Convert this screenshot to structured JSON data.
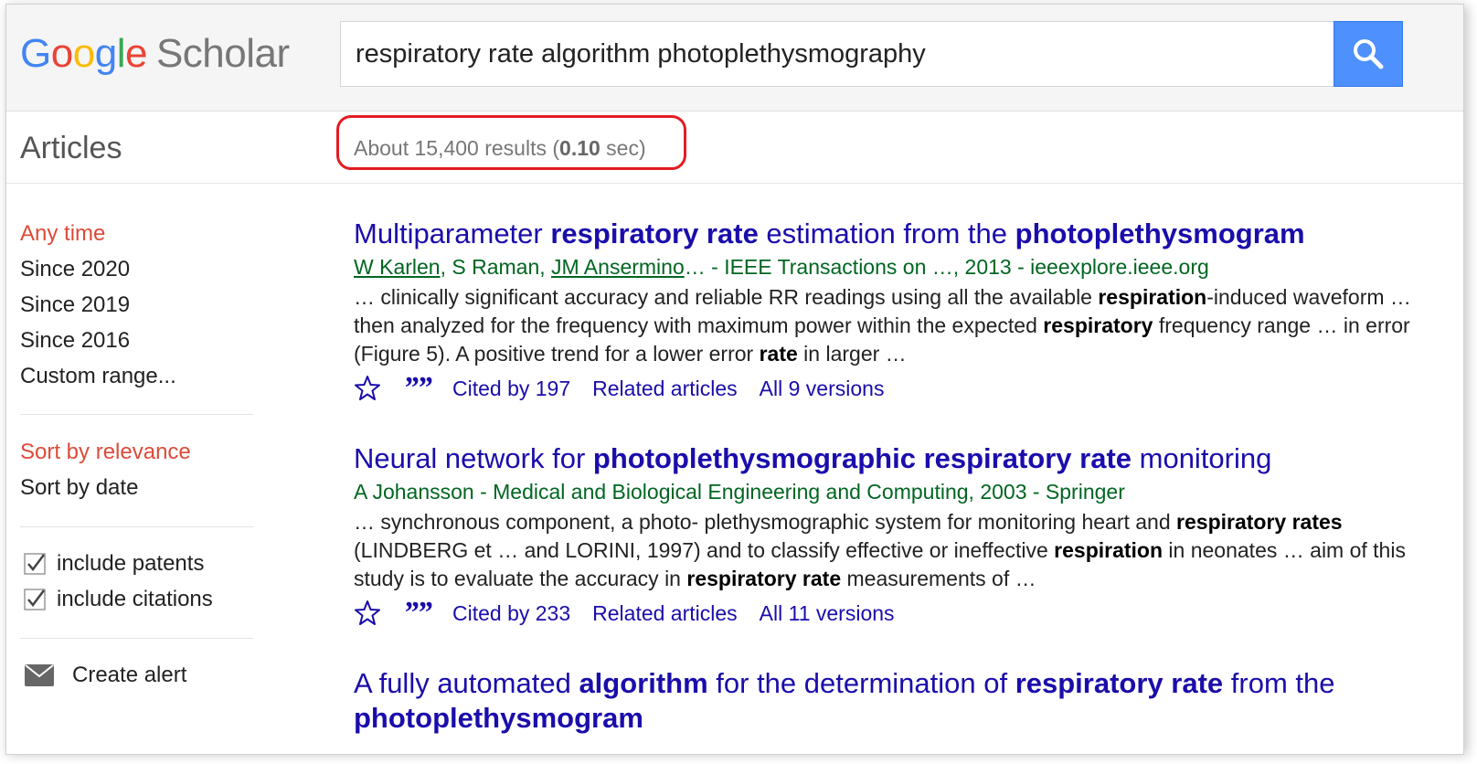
{
  "logo": {
    "g1": "G",
    "g2": "o",
    "g3": "o",
    "g4": "g",
    "g5": "l",
    "g6": "e",
    "scholar": "Scholar"
  },
  "search": {
    "query": "respiratory rate algorithm photoplethysmography",
    "button_icon": "search-icon"
  },
  "subbar": {
    "articles_label": "Articles",
    "results_prefix": "About 15,400 results (",
    "results_time": "0.10",
    "results_suffix": " sec)"
  },
  "sidebar": {
    "time_filters": [
      {
        "label": "Any time",
        "active": true
      },
      {
        "label": "Since 2020",
        "active": false
      },
      {
        "label": "Since 2019",
        "active": false
      },
      {
        "label": "Since 2016",
        "active": false
      },
      {
        "label": "Custom range...",
        "active": false
      }
    ],
    "sort_options": [
      {
        "label": "Sort by relevance",
        "active": true
      },
      {
        "label": "Sort by date",
        "active": false
      }
    ],
    "checkboxes": [
      {
        "label": "include patents",
        "checked": true
      },
      {
        "label": "include citations",
        "checked": true
      }
    ],
    "create_alert": "Create alert"
  },
  "colors": {
    "link": "#1a0dab",
    "meta_green": "#006621",
    "active_red": "#dd4b39",
    "highlight": "#e31b23",
    "search_button": "#4d90fe"
  },
  "results": [
    {
      "title": [
        {
          "text": "Multiparameter ",
          "bold": false
        },
        {
          "text": "respiratory rate",
          "bold": true
        },
        {
          "text": " estimation from the ",
          "bold": false
        },
        {
          "text": "photoplethysmogram",
          "bold": true
        }
      ],
      "authors": [
        {
          "text": "W Karlen",
          "link": true
        },
        {
          "text": ", S Raman, ",
          "link": false
        },
        {
          "text": "JM Ansermino",
          "link": true
        }
      ],
      "meta_rest": "… - IEEE Transactions on …, 2013 - ieeexplore.ieee.org",
      "snippet": [
        {
          "text": "… clinically significant accuracy and reliable RR readings using all the available ",
          "bold": false
        },
        {
          "text": "respiration",
          "bold": true
        },
        {
          "text": "-induced waveform … then analyzed for the frequency with maximum power within the expected ",
          "bold": false
        },
        {
          "text": "respiratory",
          "bold": true
        },
        {
          "text": " frequency range … in error (Figure 5). A positive trend for a lower error ",
          "bold": false
        },
        {
          "text": "rate",
          "bold": true
        },
        {
          "text": " in larger …",
          "bold": false
        }
      ],
      "cited_by": "Cited by 197",
      "related": "Related articles",
      "versions": "All 9 versions"
    },
    {
      "title": [
        {
          "text": "Neural network for ",
          "bold": false
        },
        {
          "text": "photoplethysmographic respiratory rate",
          "bold": true
        },
        {
          "text": " monitoring",
          "bold": false
        }
      ],
      "authors": [],
      "meta_rest": "A Johansson - Medical and Biological Engineering and Computing, 2003 - Springer",
      "snippet": [
        {
          "text": "… synchronous component, a photo- plethysmographic system for monitoring heart and ",
          "bold": false
        },
        {
          "text": "respiratory rates",
          "bold": true
        },
        {
          "text": " (LINDBERG et … and LORINI, 1997) and to classify effective or ineffective ",
          "bold": false
        },
        {
          "text": "respiration",
          "bold": true
        },
        {
          "text": " in neonates … aim of this study is to evaluate the accuracy in ",
          "bold": false
        },
        {
          "text": "respiratory rate",
          "bold": true
        },
        {
          "text": " measurements of …",
          "bold": false
        }
      ],
      "cited_by": "Cited by 233",
      "related": "Related articles",
      "versions": "All 11 versions"
    },
    {
      "title": [
        {
          "text": "A fully automated ",
          "bold": false
        },
        {
          "text": "algorithm",
          "bold": true
        },
        {
          "text": " for the determination of ",
          "bold": false
        },
        {
          "text": "respiratory rate",
          "bold": true
        },
        {
          "text": " from the ",
          "bold": false
        },
        {
          "text": "photoplethysmogram",
          "bold": true
        }
      ],
      "authors": [],
      "meta_rest": "",
      "snippet": [],
      "cited_by": "",
      "related": "",
      "versions": ""
    }
  ]
}
